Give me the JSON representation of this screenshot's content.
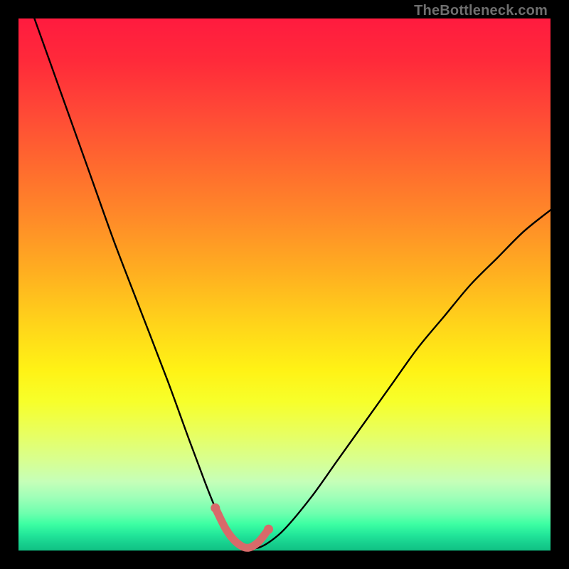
{
  "watermark": "TheBottleneck.com",
  "chart_data": {
    "type": "line",
    "title": "",
    "xlabel": "",
    "ylabel": "",
    "xlim": [
      0,
      100
    ],
    "ylim": [
      0,
      100
    ],
    "series": [
      {
        "name": "bottleneck-curve",
        "x": [
          3,
          8,
          13,
          18,
          23,
          28,
          32,
          35,
          37,
          39,
          41,
          43,
          45,
          47,
          50,
          55,
          60,
          65,
          70,
          75,
          80,
          85,
          90,
          95,
          100
        ],
        "y": [
          100,
          86,
          72,
          58,
          45,
          32,
          21,
          13,
          8,
          4,
          1.5,
          0.5,
          0.5,
          1.5,
          4,
          10,
          17,
          24,
          31,
          38,
          44,
          50,
          55,
          60,
          64
        ]
      },
      {
        "name": "optimal-zone-highlight",
        "x": [
          37,
          39,
          41,
          43,
          45,
          47
        ],
        "y": [
          8,
          4,
          1.5,
          0.5,
          1.5,
          4
        ]
      }
    ],
    "gradient_stops": [
      {
        "pos": 0,
        "color": "#ff1b3f"
      },
      {
        "pos": 50,
        "color": "#ffd61a"
      },
      {
        "pos": 75,
        "color": "#f7ff2a"
      },
      {
        "pos": 100,
        "color": "#10c184"
      }
    ]
  }
}
